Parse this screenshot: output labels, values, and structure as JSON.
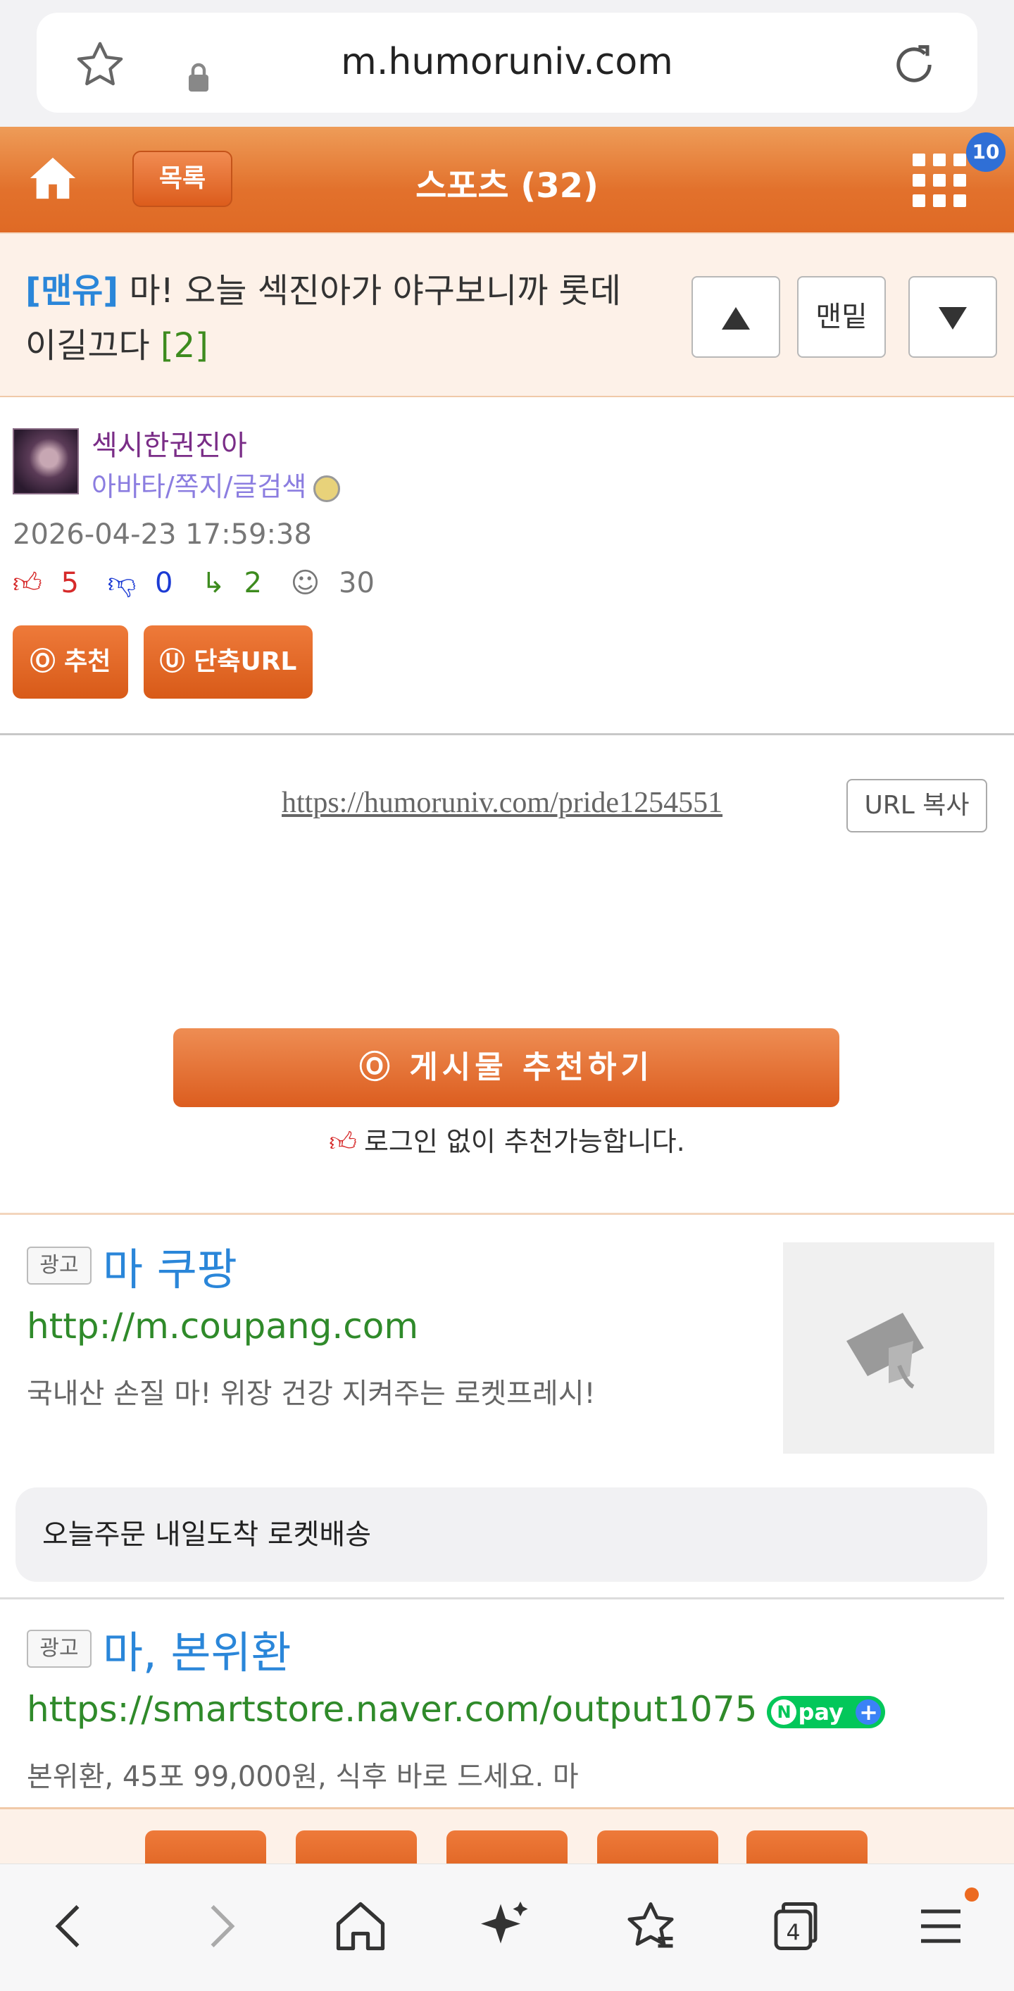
{
  "browser": {
    "url": "m.humoruniv.com",
    "tab_count": "4",
    "icons": [
      "star-icon",
      "lock-icon",
      "reload-icon",
      "back-icon",
      "forward-icon",
      "home-icon",
      "sparkle-icon",
      "favorites-icon",
      "tabs-icon",
      "menu-icon"
    ]
  },
  "header": {
    "list_label": "목록",
    "board_title": "스포츠 (32)",
    "notification_count": "10",
    "accent_color": "#e2712c"
  },
  "post": {
    "category": "[맨유]",
    "title": "마! 오늘 섹진아가 야구보니까 롯데 이길끄다",
    "comment_count": "[2]",
    "nav_bottom_label": "맨밑"
  },
  "author": {
    "nickname": "섹시한권진아",
    "links": "아바타/쪽지/글검색",
    "date": "2026-04-23 17:59:38",
    "upvotes": "5",
    "downvotes": "0",
    "comments": "2",
    "views": "30",
    "recommend_label": "추천",
    "short_url_label": "단축URL"
  },
  "url_row": {
    "link": "https://humoruniv.com/pride1254551",
    "copy_label": "URL 복사"
  },
  "recommend": {
    "button_label": "게시물  추천하기",
    "note": "로그인 없이 추천가능합니다."
  },
  "ads": [
    {
      "tag": "광고",
      "title": "마 쿠팡",
      "url": "http://m.coupang.com",
      "description": "국내산 손질 마! 위장 건강 지켜주는 로켓프레시!",
      "extension": "오늘주문 내일도착 로켓배송"
    },
    {
      "tag": "광고",
      "title": "마, 본위환",
      "url": "https://smartstore.naver.com/output1075",
      "badge": "pay",
      "description": "본위환, 45포 99,000원, 식후 바로 드세요. 마"
    }
  ]
}
